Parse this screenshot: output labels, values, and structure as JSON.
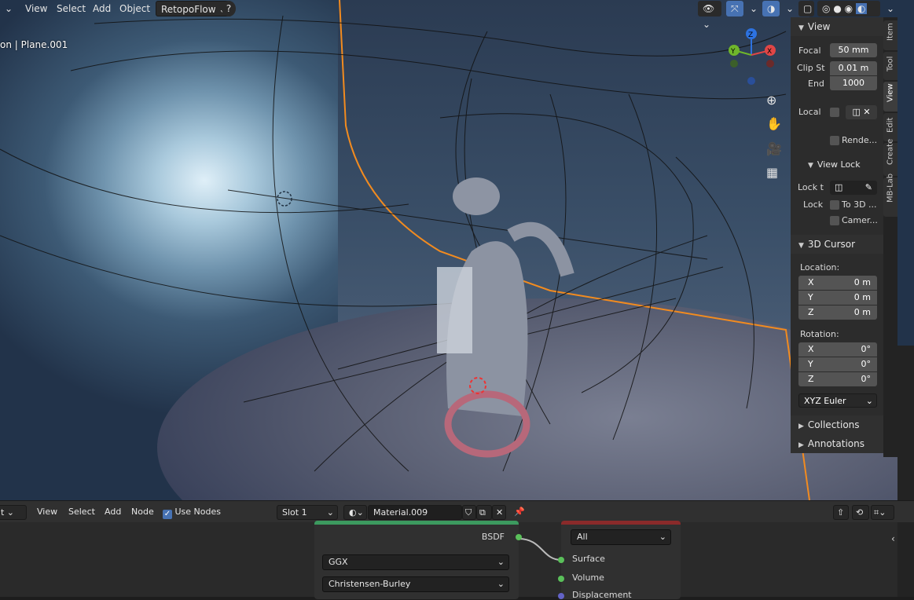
{
  "header": {
    "left_menu": [
      "View",
      "Select",
      "Add",
      "Object"
    ],
    "addon": "RetopoFlow",
    "help_icon": "question-icon"
  },
  "viewport": {
    "object_label": "on | Plane.001"
  },
  "gizmo": {
    "axes": [
      "Z",
      "Y",
      "X"
    ]
  },
  "tabs": [
    "Item",
    "Tool",
    "View",
    "Edit",
    "Create",
    "MB-Lab"
  ],
  "active_tab": "View",
  "view_panel": {
    "title": "View",
    "focal_label": "Focal",
    "focal_value": "50 mm",
    "clip_start_label": "Clip St",
    "clip_start_value": "0.01 m",
    "clip_end_label": "End",
    "clip_end_value": "1000",
    "local_label": "Local",
    "render_label": "Rende...",
    "view_lock_title": "View Lock",
    "lock_to_label": "Lock t",
    "lock_label": "Lock",
    "to3d_label": "To 3D ...",
    "camera_label": "Camer..."
  },
  "cursor_panel": {
    "title": "3D Cursor",
    "location_label": "Location:",
    "loc": [
      {
        "axis": "X",
        "value": "0 m"
      },
      {
        "axis": "Y",
        "value": "0 m"
      },
      {
        "axis": "Z",
        "value": "0 m"
      }
    ],
    "rotation_label": "Rotation:",
    "rot": [
      {
        "axis": "X",
        "value": "0°"
      },
      {
        "axis": "Y",
        "value": "0°"
      },
      {
        "axis": "Z",
        "value": "0°"
      }
    ],
    "rotation_mode": "XYZ Euler"
  },
  "collapsed_panels": [
    "Collections",
    "Annotations"
  ],
  "node_header": {
    "menu": [
      "View",
      "Select",
      "Add",
      "Node"
    ],
    "use_nodes_label": "Use Nodes",
    "slot": "Slot 1",
    "material": "Material.009"
  },
  "nodes": {
    "bsdf_output": "BSDF",
    "distribution": "GGX",
    "subsurface": "Christensen-Burley",
    "target": "All",
    "inputs": [
      "Surface",
      "Volume",
      "Displacement"
    ]
  },
  "colors": {
    "accent": "#4772b3",
    "selection": "#f28b1f",
    "shader_green": "#3c9a5f",
    "output_red": "#8a2a2a"
  }
}
